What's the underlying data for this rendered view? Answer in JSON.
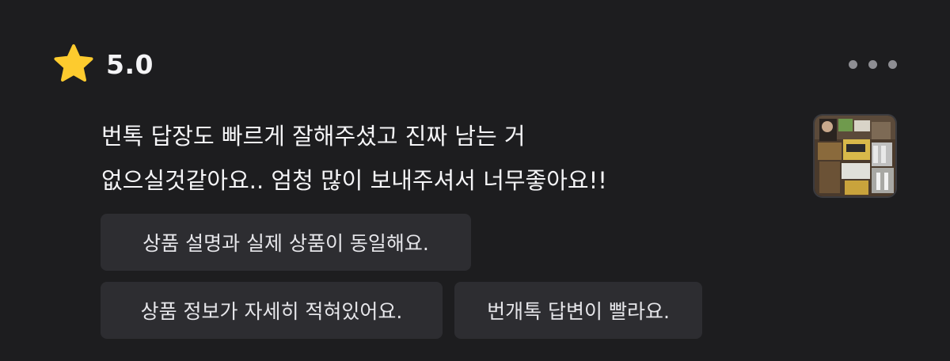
{
  "rating": {
    "value": "5.0",
    "icon": "star-icon",
    "star_color": "#FDCB2E"
  },
  "menu": {
    "icon": "more-horizontal-icon"
  },
  "review": {
    "lines": [
      "번톡 답장도 빠르게 잘해주셨고 진짜 남는 거",
      "없으실것같아요.. 엄청 많이 보내주셔서 너무좋아요!!"
    ],
    "photo_icon": "review-photo"
  },
  "tags": [
    "상품 설명과 실제 상품이 동일해요.",
    "상품 정보가 자세히 적혀있어요.",
    "번개톡 답변이 빨라요."
  ],
  "colors": {
    "background": "#1D1D1F",
    "tag_background": "#2D2D31",
    "text": "#F5F5F7",
    "muted": "#8E8E93"
  }
}
